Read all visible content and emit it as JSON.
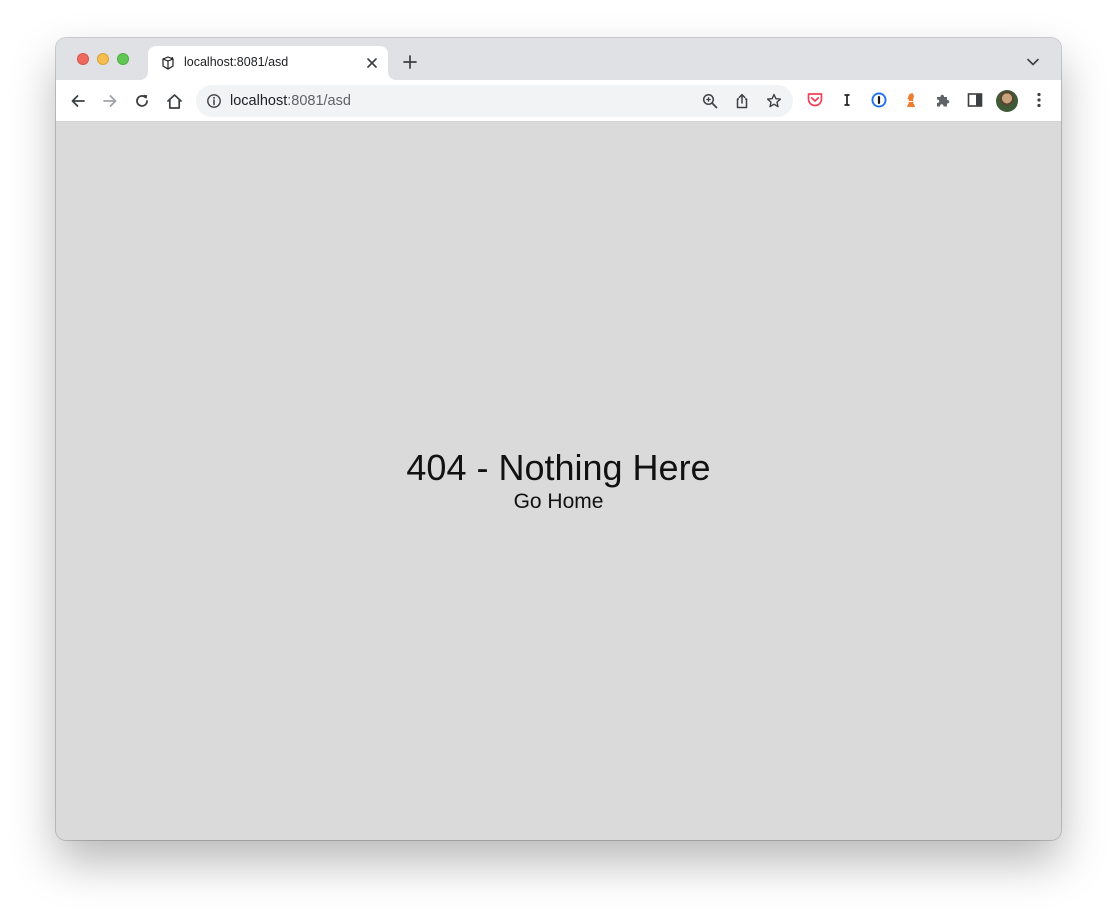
{
  "browser": {
    "tab": {
      "title": "localhost:8081/asd",
      "favicon": "vite-logo-icon"
    },
    "address_bar": {
      "host": "localhost",
      "rest": ":8081/asd"
    },
    "extensions": [
      "pocket-icon",
      "instapaper-icon",
      "1password-icon",
      "chess-icon",
      "puzzle-icon"
    ],
    "colors": {
      "tabstrip": "#dfe1e5",
      "toolbar": "#ffffff",
      "page_background": "#dadada",
      "pocket": "#ef4056",
      "onepassword": "#1a73e8",
      "chess": "#f07c2f"
    }
  },
  "page": {
    "heading": "404 - Nothing Here",
    "link": "Go Home"
  }
}
